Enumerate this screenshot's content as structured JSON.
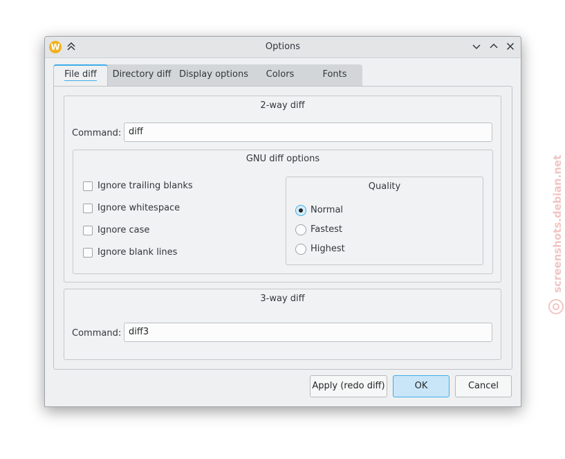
{
  "window": {
    "title": "Options",
    "app_icon_letter": "W"
  },
  "tabs": [
    "File diff",
    "Directory diff",
    "Display options",
    "Colors",
    "Fonts"
  ],
  "two_way": {
    "title": "2-way diff",
    "command_label": "Command:",
    "command_value": "diff"
  },
  "gnu": {
    "title": "GNU diff options",
    "checkboxes": [
      "Ignore trailing blanks",
      "Ignore whitespace",
      "Ignore case",
      "Ignore blank lines"
    ]
  },
  "quality": {
    "title": "Quality",
    "options": [
      "Normal",
      "Fastest",
      "Highest"
    ],
    "selected": "Normal"
  },
  "three_way": {
    "title": "3-way diff",
    "command_label": "Command:",
    "command_value": "diff3"
  },
  "buttons": {
    "apply": "Apply (redo diff)",
    "ok": "OK",
    "cancel": "Cancel"
  },
  "watermark": "screenshots.debian.net",
  "colors": {
    "accent": "#3daee9",
    "watermark": "#f2c4c4"
  }
}
